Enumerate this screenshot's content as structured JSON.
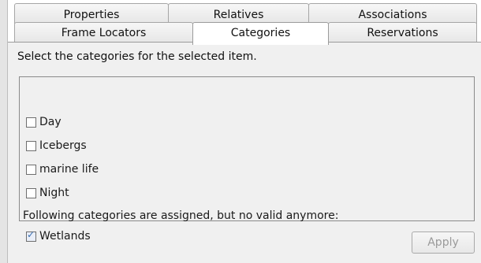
{
  "tabs": {
    "row1": [
      "Properties",
      "Relatives",
      "Associations"
    ],
    "row2": [
      "Frame Locators",
      "Categories",
      "Reservations"
    ],
    "active": "Categories"
  },
  "panel": {
    "instruction": "Select the categories for the selected item.",
    "categories": [
      {
        "label": "Day",
        "checked": false
      },
      {
        "label": "Icebergs",
        "checked": false
      },
      {
        "label": "marine life",
        "checked": false
      },
      {
        "label": "Night",
        "checked": false
      }
    ],
    "invalid_note": "Following categories are assigned, but no valid anymore:",
    "invalid_categories": [
      {
        "label": "Wetlands",
        "checked": true
      }
    ],
    "apply_label": "Apply",
    "apply_enabled": false
  },
  "colors": {
    "panel_bg": "#f0f0f0",
    "check_mark": "#3a6fb0",
    "disabled_text": "#9a9a9a"
  },
  "icons": {
    "check": "check-icon"
  }
}
